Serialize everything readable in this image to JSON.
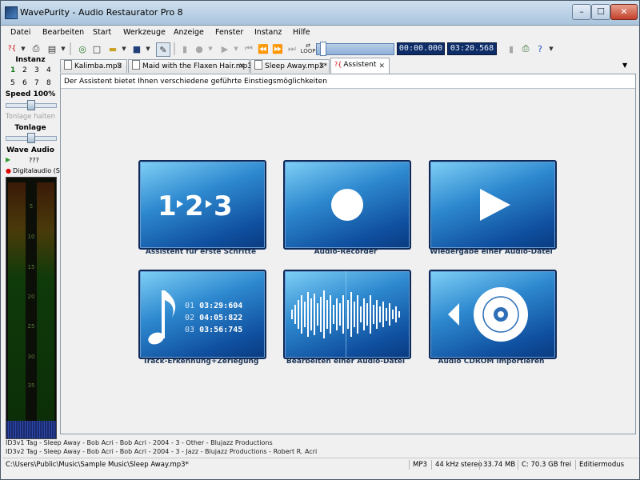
{
  "window": {
    "title": "WavePurity - Audio Restaurator Pro 8"
  },
  "menu": [
    "Datei",
    "Bearbeiten",
    "Start",
    "Werkzeuge",
    "Anzeige",
    "Fenster",
    "Instanz",
    "Hilfe"
  ],
  "transport": {
    "position": "00:00.000",
    "length": "03:20.568",
    "loop_label": "LOOP",
    "progress": 0.04
  },
  "left_panel": {
    "instanz_label": "Instanz",
    "instances_row1": [
      "1",
      "2",
      "3",
      "4"
    ],
    "instances_row2": [
      "5",
      "6",
      "7",
      "8"
    ],
    "speed_label": "Speed 100%",
    "tonlage_halten": "Tonlage halten",
    "tonlage_label": "Tonlage",
    "wave_audio_label": "Wave Audio",
    "wave_value": "???",
    "device": "Digitalaudio (S/",
    "vu_ticks": [
      "5",
      "10",
      "15",
      "20",
      "25",
      "30",
      "35"
    ]
  },
  "tabs": [
    {
      "label": "Kalimba.mp3",
      "active": false
    },
    {
      "label": "Maid with the Flaxen Hair.mp3",
      "active": false
    },
    {
      "label": "Sleep Away.mp3*",
      "active": false
    },
    {
      "label": "Assistent",
      "active": true
    }
  ],
  "assistant": {
    "info": "Der Assistent bietet Ihnen verschiedene geführte Einstiegsmöglichkeiten",
    "tiles": [
      {
        "label": "Assistent für erste Schritte",
        "icon": "steps-123-icon"
      },
      {
        "label": "Audio-Recorder",
        "icon": "record-icon"
      },
      {
        "label": "Wiedergabe einer Audio-Datei",
        "icon": "play-icon"
      },
      {
        "label": "Track-Erkennung+Zerlegung",
        "icon": "music-note-icon",
        "tracks": [
          {
            "num": "01",
            "time": "03:29:604"
          },
          {
            "num": "02",
            "time": "04:05:822"
          },
          {
            "num": "03",
            "time": "03:56:745"
          }
        ]
      },
      {
        "label": "Bearbeiten einer Audio-Datei",
        "icon": "waveform-icon"
      },
      {
        "label": "Audio CDROM importieren",
        "icon": "cdrom-icon"
      }
    ]
  },
  "id3": {
    "v1": "ID3v1 Tag - Sleep Away - Bob Acri - Bob Acri - 2004 - 3 - Other - Blujazz Productions",
    "v2": "ID3v2 Tag - Sleep Away - Bob Acri - Bob Acri - 2004 - 3 - Jazz - Blujazz Productions - Robert R. Acri"
  },
  "status": {
    "path": "C:\\Users\\Public\\Music\\Sample Music\\Sleep Away.mp3*",
    "format": "MP3",
    "quality": "44 kHz stereo",
    "size": "33.74 MB",
    "free": "C: 70.3 GB frei",
    "mode": "Editiermodus"
  }
}
